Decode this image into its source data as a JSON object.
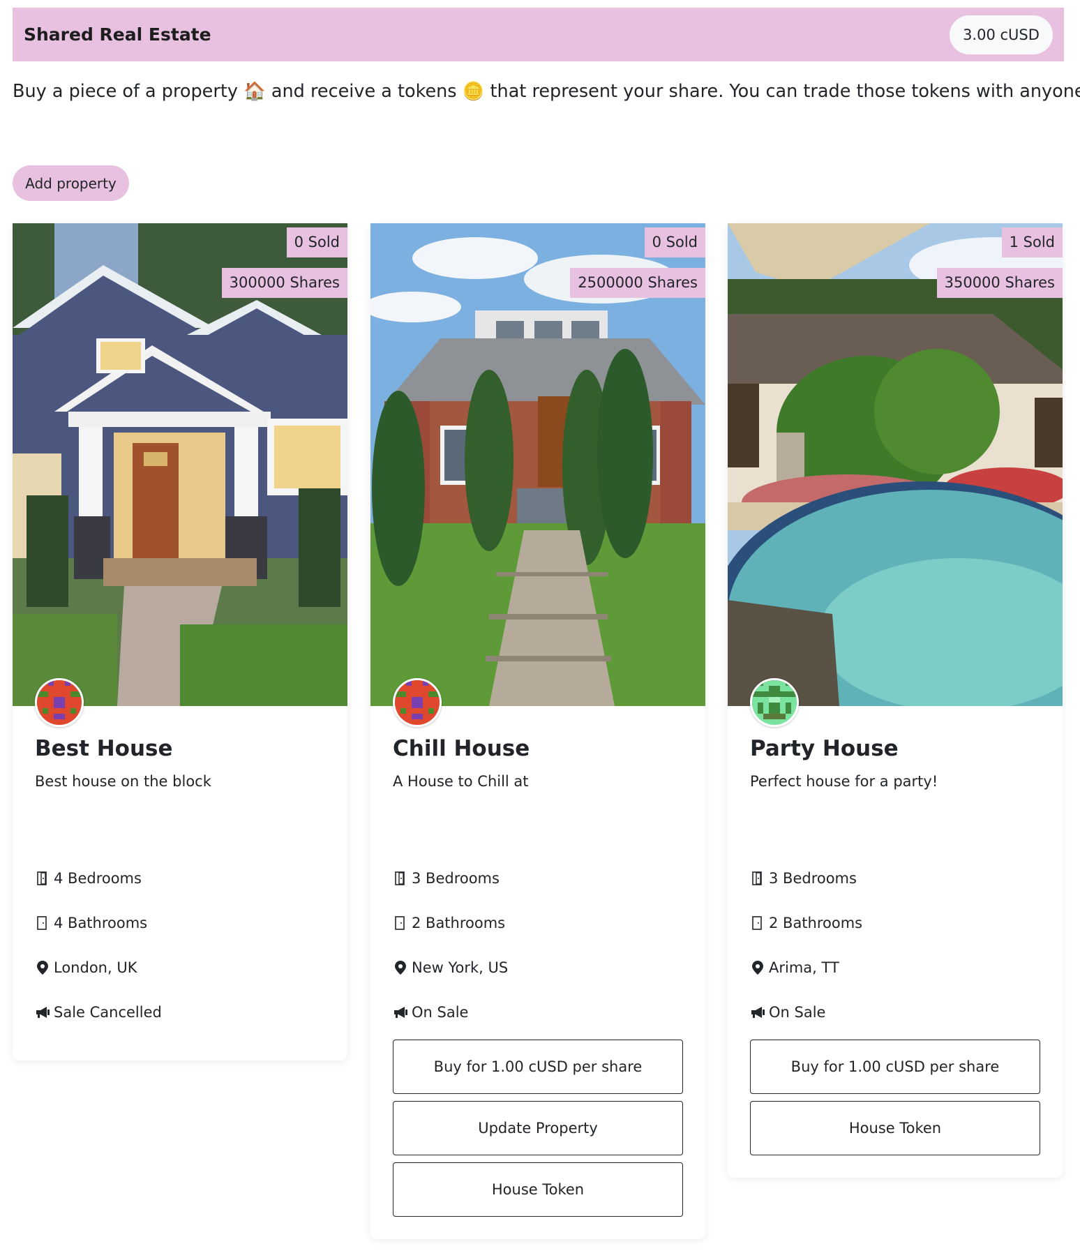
{
  "navbar": {
    "brand": "Shared Real Estate",
    "balance": "3.00 cUSD"
  },
  "intro": {
    "text": "Buy a piece of a property 🏠 and receive a tokens 🪙 that represent your share. You can trade those tokens with anyone."
  },
  "add_property_label": "Add property",
  "properties": [
    {
      "sold": "0 Sold",
      "shares": "300000 Shares",
      "name": "Best House",
      "description": "Best house on the block",
      "bedrooms": "4 Bedrooms",
      "bathrooms": "4 Bathrooms",
      "location": "London, UK",
      "status": "Sale Cancelled",
      "buttons": []
    },
    {
      "sold": "0 Sold",
      "shares": "2500000 Shares",
      "name": "Chill House",
      "description": "A House to Chill at",
      "bedrooms": "3 Bedrooms",
      "bathrooms": "2 Bathrooms",
      "location": "New York, US",
      "status": "On Sale",
      "buttons": [
        "Buy for 1.00 cUSD per share",
        "Update Property",
        "House Token"
      ]
    },
    {
      "sold": "1 Sold",
      "shares": "350000 Shares",
      "name": "Party House",
      "description": "Perfect house for a party!",
      "bedrooms": "3 Bedrooms",
      "bathrooms": "2 Bathrooms",
      "location": "Arima, TT",
      "status": "On Sale",
      "buttons": [
        "Buy for 1.00 cUSD per share",
        "House Token"
      ]
    }
  ],
  "icons": {
    "bedroom": "door-icon",
    "bathroom": "door-closed-icon",
    "location": "map-pin-icon",
    "status": "megaphone-icon"
  },
  "colors": {
    "accent": "#e7c1df",
    "text": "#212529"
  }
}
